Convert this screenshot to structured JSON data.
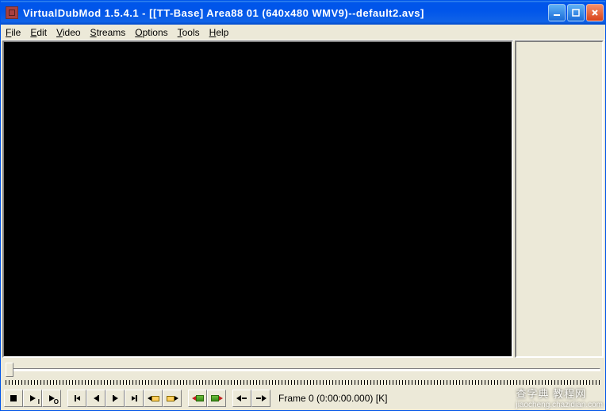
{
  "title": "VirtualDubMod 1.5.4.1 - [[TT-Base] Area88 01 (640x480 WMV9)--default2.avs]",
  "menu": {
    "file": {
      "pre": "F",
      "rest": "ile"
    },
    "edit": {
      "pre": "E",
      "rest": "dit"
    },
    "video": {
      "pre": "V",
      "rest": "ideo"
    },
    "streams": {
      "pre": "S",
      "rest": "treams"
    },
    "options": {
      "pre": "O",
      "rest": "ptions"
    },
    "tools": {
      "pre": "T",
      "rest": "ools"
    },
    "help": {
      "pre": "H",
      "rest": "elp"
    }
  },
  "status": "Frame 0 (0:00:00.000) [K]",
  "toolbar": {
    "stop": "stop-button",
    "play_i": "play-input-button",
    "play_o": "play-output-button",
    "go_start": "go-start-button",
    "step_back": "step-back-button",
    "step_fwd": "step-forward-button",
    "go_end": "go-end-button",
    "key_prev": "prev-keyframe-button",
    "key_next": "next-keyframe-button",
    "scene_prev": "prev-scene-button",
    "scene_next": "next-scene-button",
    "mark_in": "mark-in-button",
    "mark_out": "mark-out-button"
  },
  "watermark": {
    "main": "查字典",
    "sub": "jiaocheng.chazidian.com",
    "tag": "教程网"
  }
}
